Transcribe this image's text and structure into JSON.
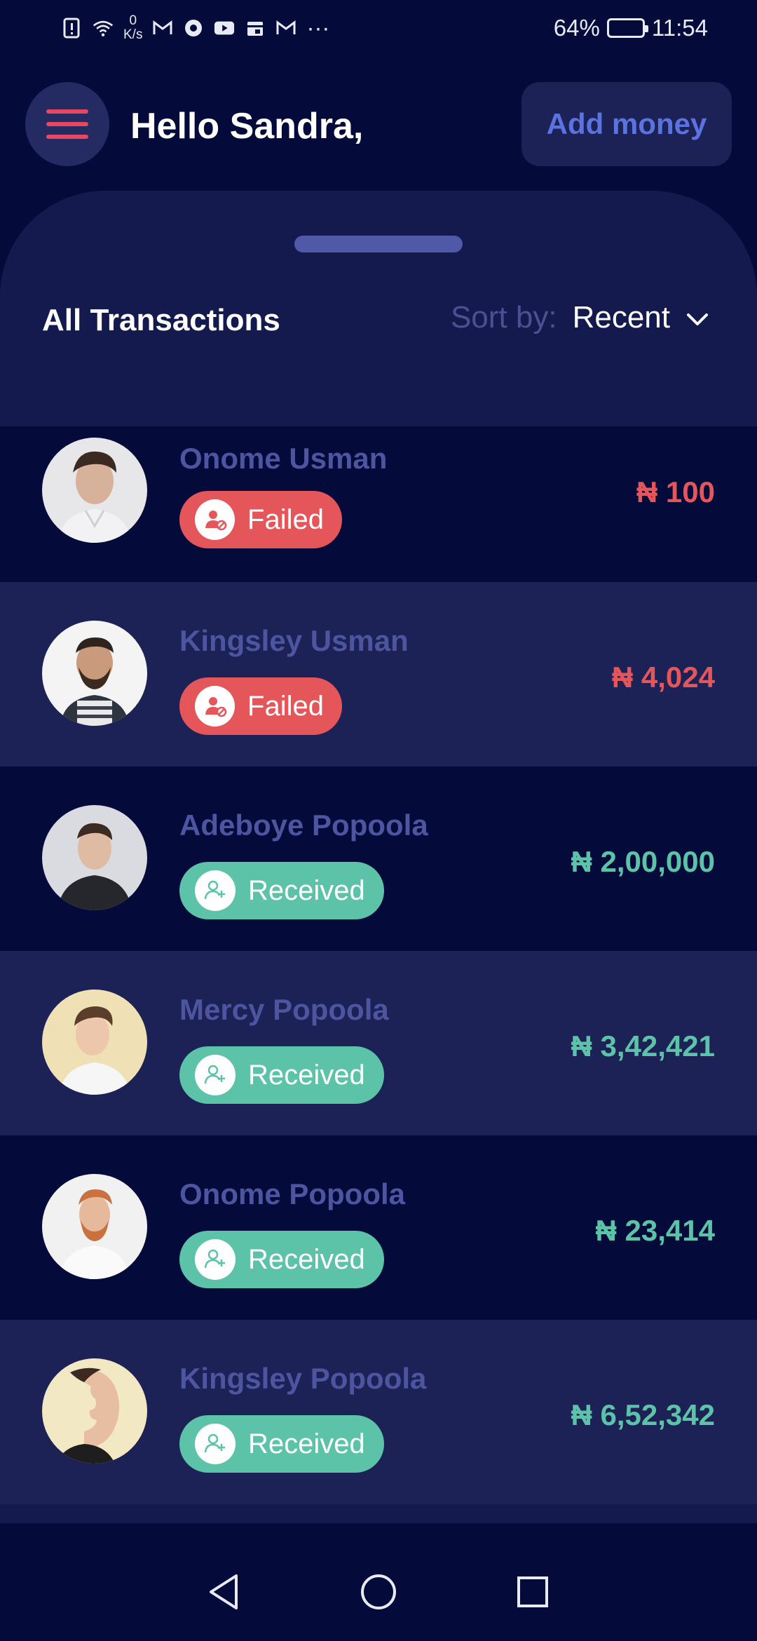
{
  "status_bar": {
    "speed_value": "0",
    "speed_unit": "K/s",
    "battery": "64%",
    "battery_level": 0.64,
    "time": "11:54",
    "more": "···"
  },
  "header": {
    "greeting": "Hello Sandra,",
    "add_money_label": "Add money"
  },
  "transactions": {
    "title": "All Transactions",
    "sort_label": "Sort by:",
    "sort_value": "Recent",
    "items": [
      {
        "name": "Onome Usman",
        "status": "Failed",
        "amount": "₦ 100"
      },
      {
        "name": "Kingsley Usman",
        "status": "Failed",
        "amount": "₦ 4,024"
      },
      {
        "name": "Adeboye Popoola",
        "status": "Received",
        "amount": "₦ 2,00,000"
      },
      {
        "name": "Mercy Popoola",
        "status": "Received",
        "amount": "₦ 3,42,421"
      },
      {
        "name": "Onome Popoola",
        "status": "Received",
        "amount": "₦ 23,414"
      },
      {
        "name": "Kingsley Popoola",
        "status": "Received",
        "amount": "₦ 6,52,342"
      }
    ]
  },
  "colors": {
    "background": "#040b3a",
    "sheet": "#141a4e",
    "accent": "#5b73e0",
    "failed": "#e4565a",
    "received": "#5cc3a8"
  },
  "icons": {
    "menu": "hamburger-icon",
    "sort": "chevron-down-icon",
    "failed": "user-blocked-icon",
    "received": "user-add-icon",
    "nav": [
      "back-icon",
      "home-icon",
      "recents-icon"
    ]
  }
}
